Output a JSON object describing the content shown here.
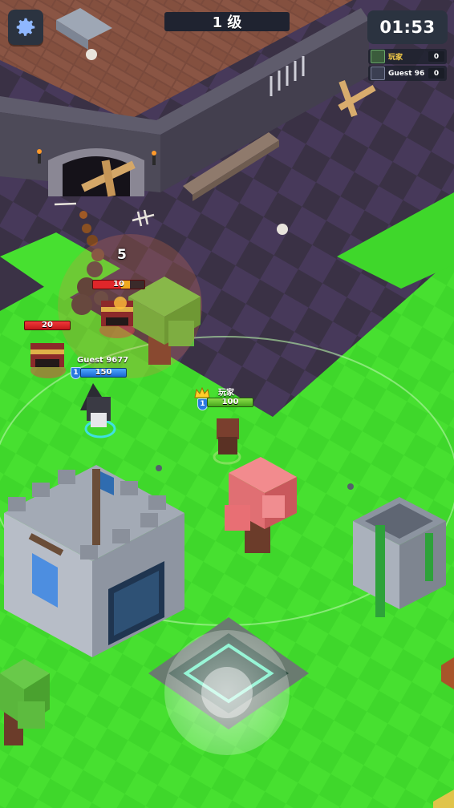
{
  "hud": {
    "level": "1 级",
    "timer": "01:53",
    "scoreboard": [
      {
        "name": "玩家",
        "score": "0",
        "is_player": true
      },
      {
        "name": "Guest 96",
        "score": "0",
        "is_player": false
      }
    ]
  },
  "units": {
    "enemy_chest_left": {
      "hp": "20"
    },
    "enemy_chest_burning": {
      "hp": "10"
    },
    "damage_popup": "5",
    "guest": {
      "name": "Guest 9677",
      "level": "1",
      "hp": "150"
    },
    "player": {
      "name": "玩家",
      "level": "1",
      "hp": "100"
    }
  },
  "icons": {
    "settings": "gear-icon",
    "crown": "crown-icon"
  },
  "colors": {
    "grass": "#3ed62a",
    "floor_dark": "#3b3246",
    "floor_light": "#4a3f57",
    "hp_red": "#e0262a",
    "hp_blue": "#2a7ae6",
    "hp_green": "#5cc02a"
  }
}
